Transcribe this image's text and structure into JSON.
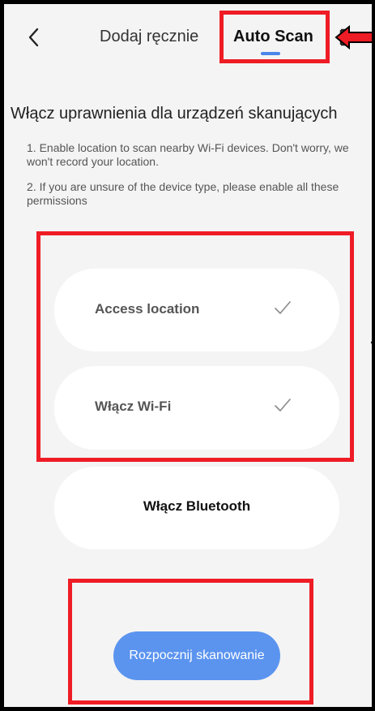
{
  "header": {
    "back_icon": "chevron-left-icon",
    "tabs": [
      {
        "label": "Dodaj ręcznie",
        "active": false
      },
      {
        "label": "Auto Scan",
        "active": true
      }
    ],
    "accent_color": "#4b86e8"
  },
  "main": {
    "heading": "Włącz uprawnienia dla urządzeń skanujących",
    "notes": [
      "1. Enable location to scan nearby Wi-Fi devices. Don't worry, we won't record your location.",
      "2. If you are unsure of the device type, please enable all these permissions"
    ],
    "permissions": [
      {
        "label": "Access location",
        "enabled": true,
        "icon": "checkmark-icon"
      },
      {
        "label": "Włącz Wi-Fi",
        "enabled": true,
        "icon": "checkmark-icon"
      },
      {
        "label": "Włącz Bluetooth",
        "enabled": false
      }
    ],
    "scan_button": {
      "label": "Rozpocznij skanowanie",
      "color": "#5b94ef"
    }
  },
  "annotations": {
    "highlight_color": "#ee1c25"
  }
}
